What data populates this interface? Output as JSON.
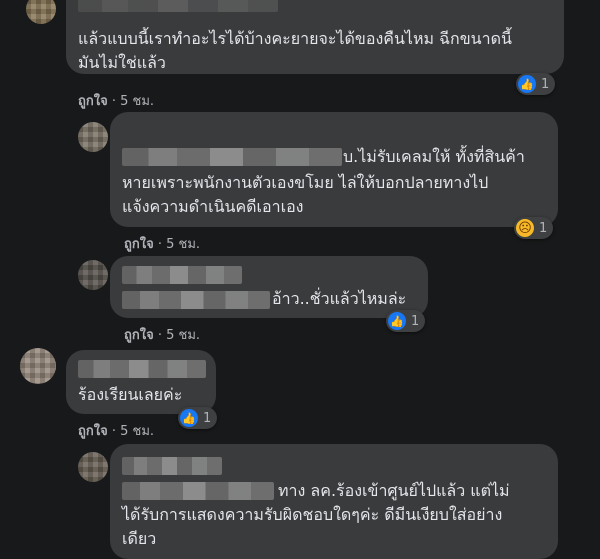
{
  "comments": [
    {
      "text_lines": [
        "แล้วแบบนี้เราทำอะไรได้บ้างคะยายจะได้ของคืนไหม ฉีกขนาดนี้",
        "มันไม่ใช่แล้ว"
      ],
      "like_label": "ถูกใจ",
      "time": "5 ชม.",
      "reaction": "like",
      "reaction_icon": "thumbs-up-icon",
      "reaction_count": "1"
    },
    {
      "text_lines": [
        "บ.ไม่รับเคลมให้ ทั้งที่สินค้า",
        "หายเพราะพนักงานตัวเองขโมย ไล่ให้บอกปลายทางไป",
        "แจ้งความดำเนินคดีเอาเอง"
      ],
      "like_label": "ถูกใจ",
      "time": "5 ชม.",
      "reaction": "sad",
      "reaction_icon": "sad-face-icon",
      "reaction_count": "1"
    },
    {
      "text_lines": [
        "อ้าว..ชั่วแล้วไหมล่ะ"
      ],
      "like_label": "ถูกใจ",
      "time": "5 ชม.",
      "reaction": "like",
      "reaction_icon": "thumbs-up-icon",
      "reaction_count": "1"
    },
    {
      "text_lines": [
        "ร้องเรียนเลยค่ะ"
      ],
      "like_label": "ถูกใจ",
      "time": "5 ชม.",
      "reaction": "like",
      "reaction_icon": "thumbs-up-icon",
      "reaction_count": "1"
    },
    {
      "text_lines": [
        "ทาง ลค.ร้องเข้าศูนย์ไปแล้ว แต่ไม่",
        "ได้รับการแสดงความรับผิดชอบใดๆค่ะ ดีมีนเงียบใส่อย่าง",
        "เดียว"
      ]
    }
  ],
  "separator": "·",
  "colors": {
    "background": "#18191a",
    "bubble": "#3a3b3c",
    "like_blue": "#1877f2"
  }
}
